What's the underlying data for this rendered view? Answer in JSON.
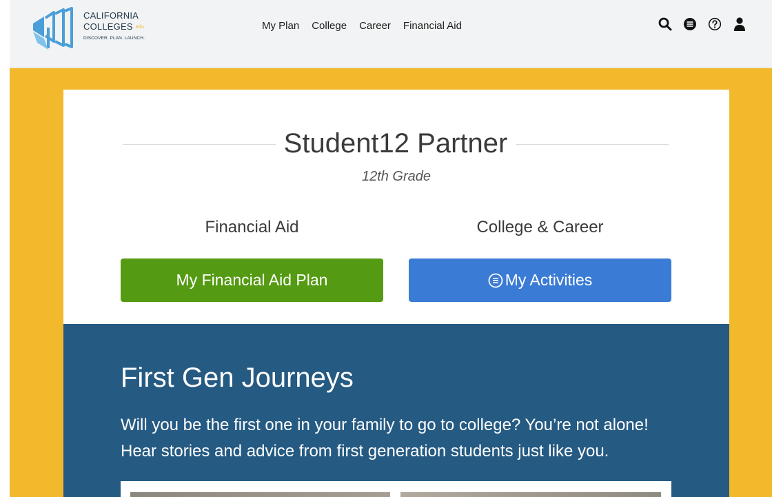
{
  "logo": {
    "line1": "CALIFORNIA",
    "line2": "COLLEGES",
    "info": ".edu",
    "tagline": "DISCOVER. PLAN. LAUNCH.",
    "colors": {
      "primary": "#4a9fd8",
      "dark": "#23384a",
      "accent": "#f2b92d"
    }
  },
  "nav": {
    "items": [
      {
        "label": "My Plan"
      },
      {
        "label": "College"
      },
      {
        "label": "Career"
      },
      {
        "label": "Financial Aid"
      }
    ]
  },
  "header_icons": [
    "search-icon",
    "messages-icon",
    "help-icon",
    "user-icon"
  ],
  "profile": {
    "name": "Student12 Partner",
    "grade": "12th Grade"
  },
  "sections": {
    "financial_aid": {
      "heading": "Financial Aid",
      "button_label": "My Financial Aid Plan",
      "button_color": "#549a12"
    },
    "college_career": {
      "heading": "College & Career",
      "button_label": "My Activities",
      "button_icon": "list-icon",
      "button_color": "#3a7bd5"
    }
  },
  "journeys": {
    "title": "First Gen Journeys",
    "body": "Will you be the first one in your family to go to college? You’re not alone! Hear stories and advice from first generation students just like you.",
    "background": "#255a82"
  },
  "theme": {
    "page_accent": "#f2b92d",
    "header_bg": "#f2f3f4"
  }
}
